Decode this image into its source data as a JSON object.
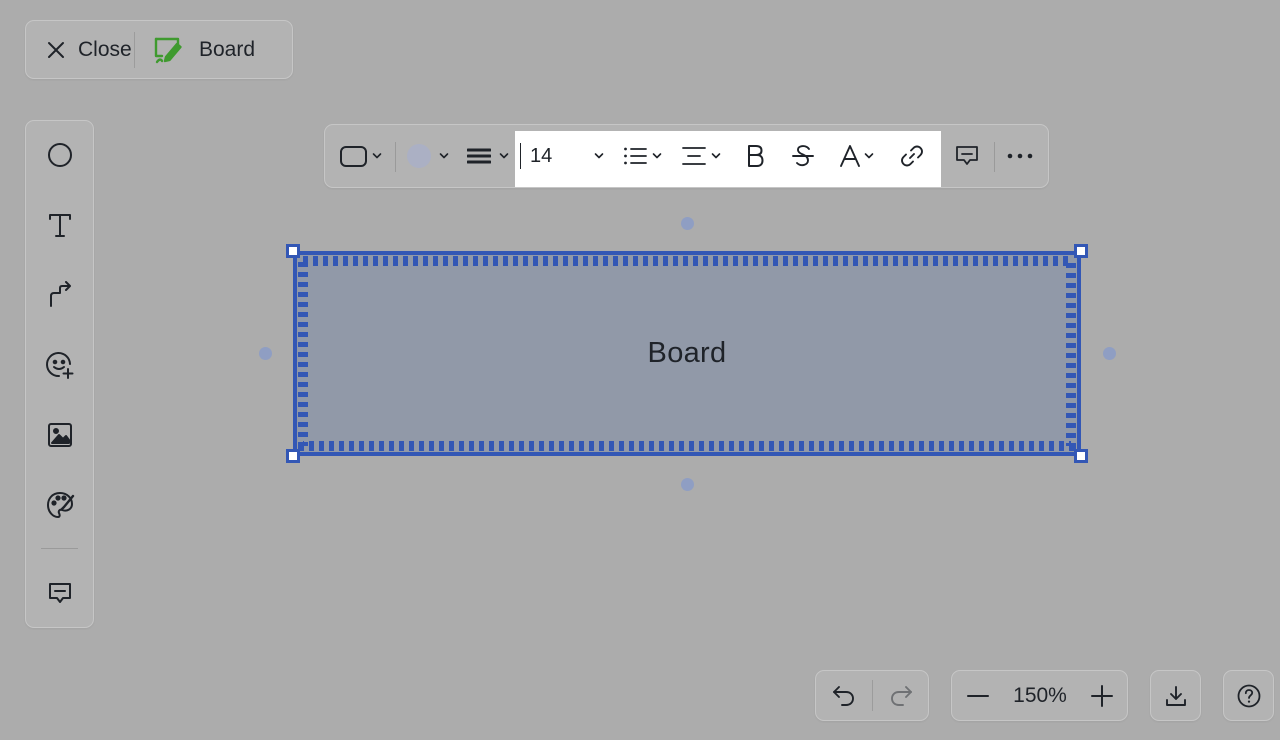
{
  "header": {
    "close_label": "Close",
    "board_label": "Board"
  },
  "left_toolbar": {
    "tools": [
      "circle-icon",
      "text-icon",
      "connector-icon",
      "sticker-add-icon",
      "image-icon",
      "palette-icon",
      "comment-icon"
    ]
  },
  "format_toolbar": {
    "shape_icon": "rounded-rect-icon",
    "fill_color": "#abb0c4",
    "font_size": "14",
    "tools": [
      "border-weight-icon",
      "bullet-list-icon",
      "align-icon",
      "bold-icon",
      "strikethrough-icon",
      "text-color-icon",
      "link-icon",
      "comment-icon",
      "more-icon"
    ]
  },
  "canvas": {
    "shape_text": "Board",
    "shape_fill": "#9199a8",
    "selection_color": "#3357b5"
  },
  "bottom_bar": {
    "zoom_level": "150%"
  },
  "colors": {
    "background": "#acacac",
    "brand_green": "#3f9a2f"
  }
}
